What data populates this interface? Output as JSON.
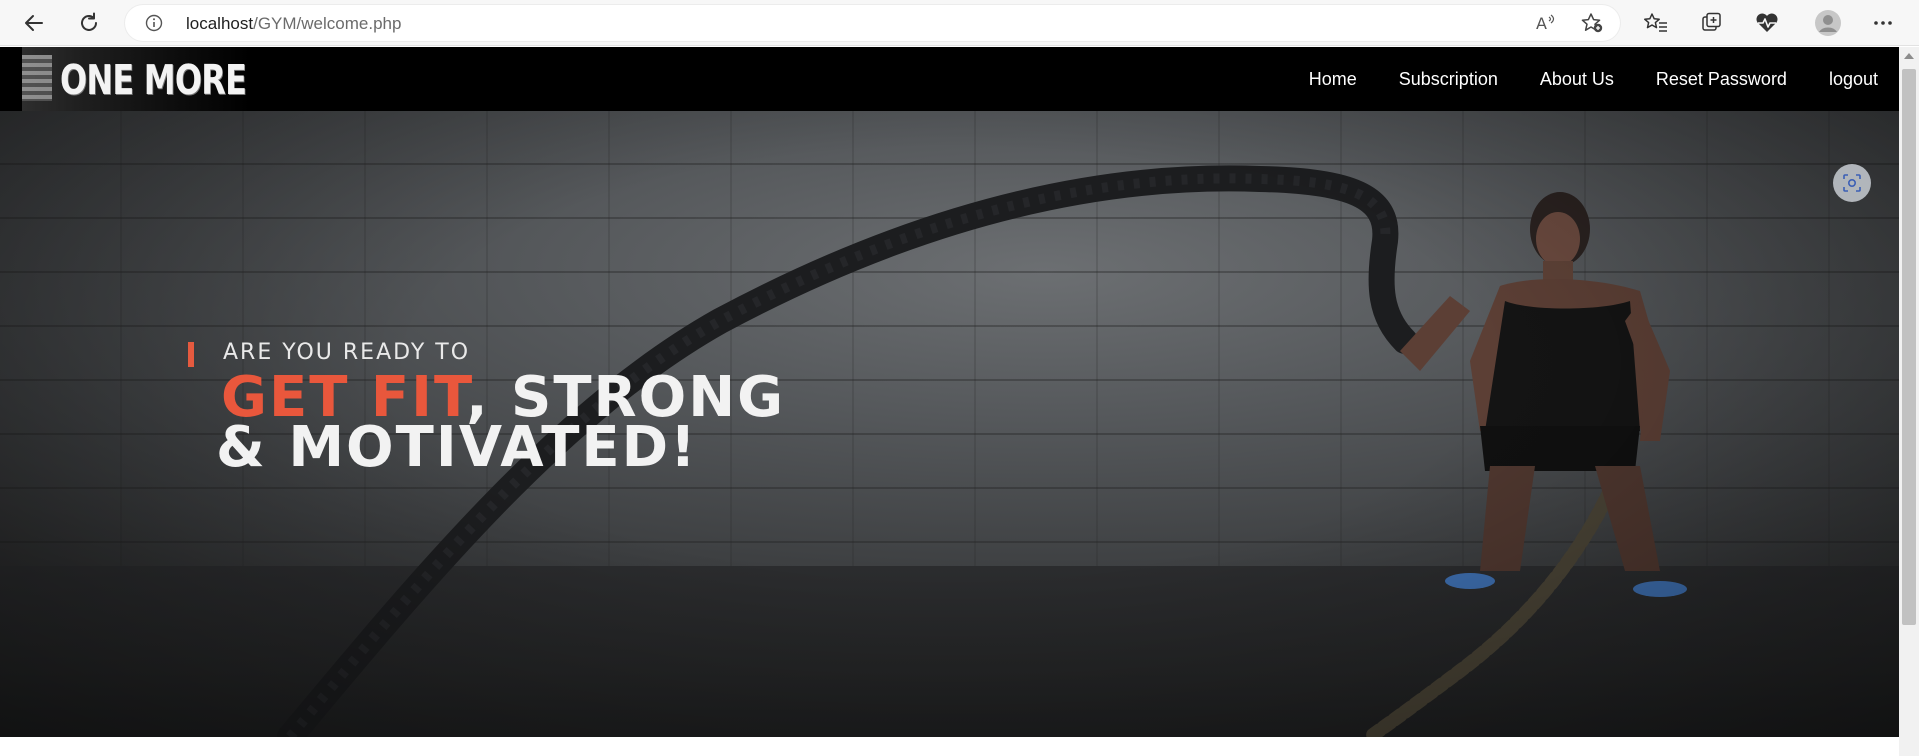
{
  "browser": {
    "url_host": "localhost",
    "url_path": "/GYM/welcome.php",
    "read_aloud_label": "A"
  },
  "site": {
    "logo_text": "ONE MORE",
    "nav": [
      {
        "label": "Home"
      },
      {
        "label": "Subscription"
      },
      {
        "label": "About Us"
      },
      {
        "label": "Reset Password"
      },
      {
        "label": "logout"
      }
    ]
  },
  "hero": {
    "kicker": "ARE YOU READY TO",
    "line1_highlight": "GET FIT",
    "line1_rest": ", STRONG",
    "line2": "& MOTIVATED!",
    "accent_color": "#e9573c"
  },
  "colors": {
    "nav_background": "#000000",
    "hero_text": "#f2f2f2",
    "browser_toolbar": "#f7f7f7"
  }
}
